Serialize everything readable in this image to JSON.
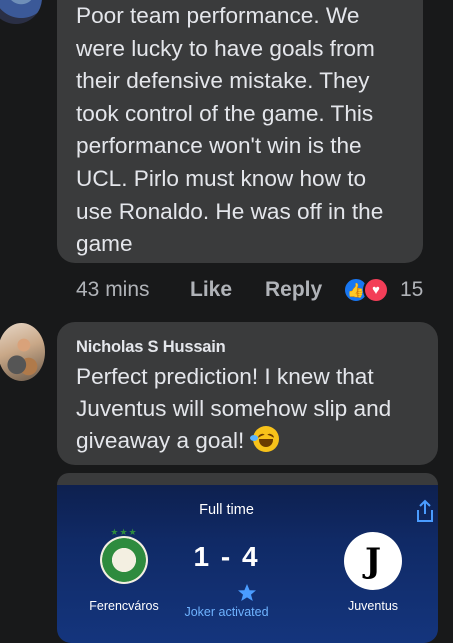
{
  "comment1": {
    "text": "Poor team performance. We\nwere lucky to have goals from\ntheir defensive mistake. They\ntook control of the game. This\nperformance won't win is the\nUCL. Pirlo must know how to\nuse Ronaldo. He was off in the\ngame",
    "time": "43 mins",
    "like_label": "Like",
    "reply_label": "Reply",
    "reaction_count": "15",
    "reactions": [
      "like-icon",
      "love-icon"
    ]
  },
  "comment2": {
    "author": "Nicholas S Hussain",
    "text": "Perfect prediction! I knew that\nJuventus will somehow slip and\ngiveaway a goal!",
    "emoji": "rolling-laughing-emoji"
  },
  "scorecard": {
    "status": "Full time",
    "home_team": "Ferencváros",
    "away_team": "Juventus",
    "score": "1 - 4",
    "joker_text": "Joker activated",
    "away_crest_letter": "J"
  },
  "colors": {
    "background": "#18191a",
    "bubble": "#3a3b3c",
    "text": "#e4e6eb",
    "muted": "#b0b3b8",
    "like_blue": "#1877f2",
    "love_red": "#f33e58",
    "joker_blue": "#6fb3ff"
  }
}
